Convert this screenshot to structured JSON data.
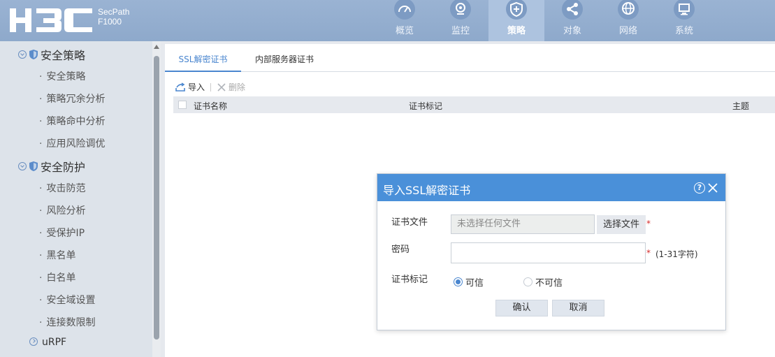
{
  "header": {
    "brand_sub_line1": "SecPath",
    "brand_sub_line2": "F1000",
    "nav": [
      {
        "label": "概览",
        "icon": "gauge-icon"
      },
      {
        "label": "监控",
        "icon": "webcam-icon"
      },
      {
        "label": "策略",
        "icon": "shield-plus-icon",
        "active": true
      },
      {
        "label": "对象",
        "icon": "share-icon"
      },
      {
        "label": "网络",
        "icon": "globe-icon"
      },
      {
        "label": "系统",
        "icon": "monitor-icon"
      }
    ]
  },
  "sidebar": {
    "group1": "安全策略",
    "group1_items": [
      "安全策略",
      "策略冗余分析",
      "策略命中分析",
      "应用风险调优"
    ],
    "group2": "安全防护",
    "group2_items": [
      "攻击防范",
      "风险分析",
      "受保护IP",
      "黑名单",
      "白名单",
      "安全域设置",
      "连接数限制"
    ],
    "group3": "uRPF"
  },
  "main": {
    "tabs": [
      "SSL解密证书",
      "内部服务器证书"
    ],
    "toolbar": {
      "import": "导入",
      "delete": "删除"
    },
    "columns": [
      "证书名称",
      "证书标记",
      "主题"
    ]
  },
  "dialog": {
    "title": "导入SSL解密证书",
    "cert_file_label": "证书文件",
    "file_placeholder": "未选择任何文件",
    "choose_file": "选择文件",
    "required": "*",
    "password_label": "密码",
    "password_hint": "(1-31字符)",
    "cert_mark_label": "证书标记",
    "trusted": "可信",
    "untrusted": "不可信",
    "confirm": "确认",
    "cancel": "取消"
  },
  "colors": {
    "accent": "#4a90d9",
    "header": "#9ab3d3"
  }
}
